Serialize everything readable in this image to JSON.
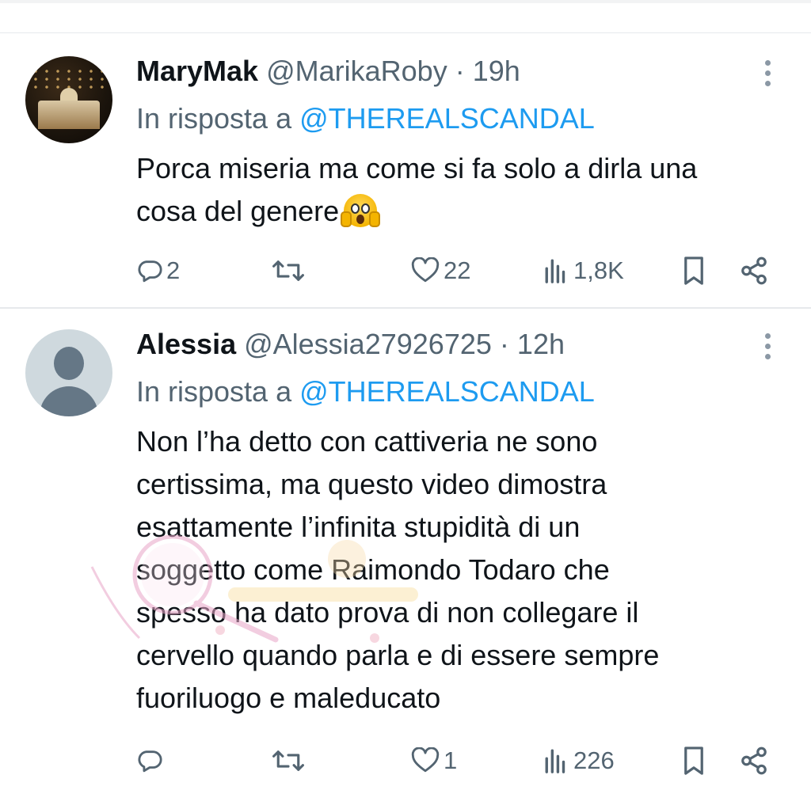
{
  "tweets": [
    {
      "display_name": "MaryMak",
      "handle": "@MarikaRoby",
      "separator": "·",
      "time": "19h",
      "reply_prefix": "In risposta a",
      "reply_mention": "@THEREALSCANDAL",
      "text_lines": [
        "Porca miseria ma come si fa solo a dirla una",
        "cosa del genere"
      ],
      "emoji": "face-screaming-in-fear",
      "avatar": "photo",
      "replies": "2",
      "retweets": "",
      "likes": "22",
      "views": "1,8K"
    },
    {
      "display_name": "Alessia",
      "handle": "@Alessia27926725",
      "separator": "·",
      "time": "12h",
      "reply_prefix": "In risposta a",
      "reply_mention": "@THEREALSCANDAL",
      "text_lines": [
        "Non l’ha detto con cattiveria ne sono",
        "certissima, ma questo video dimostra",
        "esattamente l’infinita stupidità di un",
        "soggetto come Raimondo Todaro che",
        "spesso ha dato prova di non collegare il",
        "cervello quando parla e di essere sempre",
        "fuoriluogo e maleducato"
      ],
      "avatar": "default",
      "replies": "",
      "retweets": "",
      "likes": "1",
      "views": "226"
    }
  ],
  "colors": {
    "text": "#0f1419",
    "secondary": "#536471",
    "link": "#1d9bf0",
    "divider": "#e6e9ec"
  }
}
